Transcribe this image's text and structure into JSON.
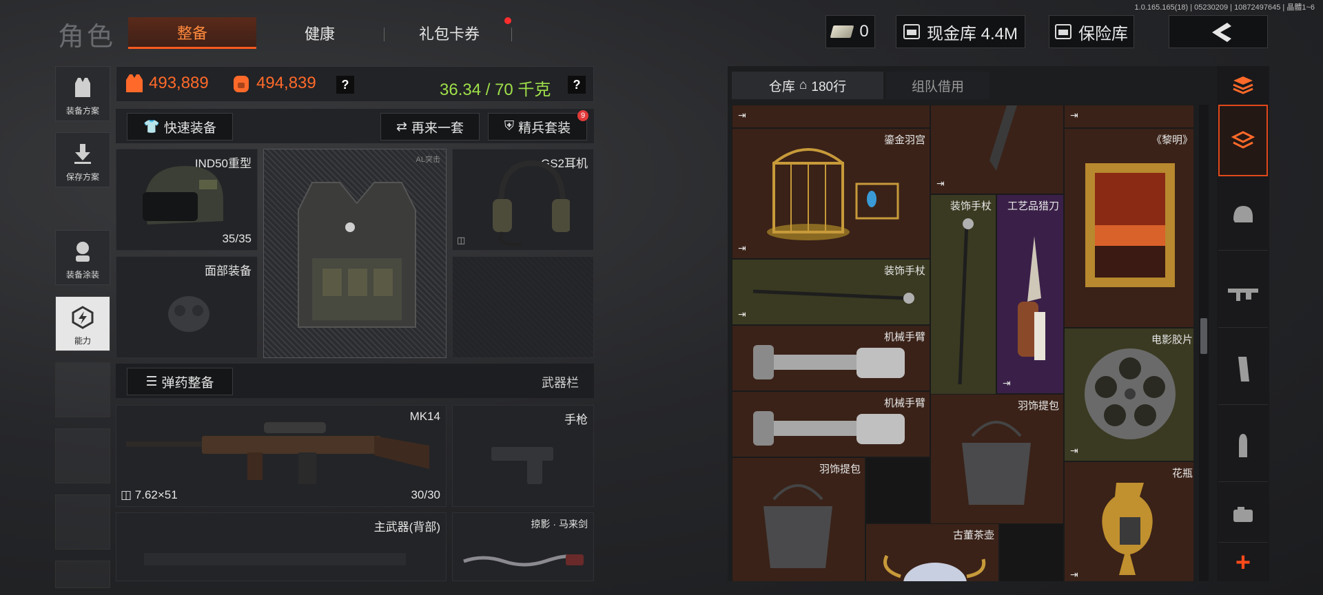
{
  "version": "1.0.165.165(18) | 05230209 | 10872497645 | 晶體1~6",
  "header": {
    "title": "角色",
    "tabs": [
      {
        "label": "整备",
        "active": true
      },
      {
        "label": "健康",
        "active": false
      },
      {
        "label": "礼包卡券",
        "active": false,
        "badge": true
      }
    ],
    "cash_count": "0",
    "vault_label": "现金库 4.4M",
    "safe_label": "保险库"
  },
  "rail": {
    "items": [
      {
        "label": "装备方案",
        "icon": "vest-icon"
      },
      {
        "label": "保存方案",
        "icon": "download-icon"
      },
      {
        "label": "装备涂装",
        "icon": "soldier-icon"
      },
      {
        "label": "能力",
        "icon": "ability-icon",
        "active": true
      }
    ]
  },
  "stats": {
    "armor_value": "493,889",
    "bag_value": "494,839",
    "weight": "36.34 / 70 千克",
    "help": "?"
  },
  "actions": {
    "quick_equip": "快速装备",
    "another_set": "再来一套",
    "elite_set": "精兵套装",
    "elite_badge": "9",
    "ammo_equip": "弹药整备",
    "weapon_bar": "武器栏"
  },
  "gear": {
    "helmet": {
      "name": "IND50重型",
      "durability": "35/35"
    },
    "armor": {
      "name": "AL突击"
    },
    "headset": {
      "name": "GS2耳机"
    },
    "face": {
      "name": "面部装备"
    },
    "primary": {
      "name": "MK14",
      "caliber": "7.62×51",
      "ammo": "30/30"
    },
    "pistol": {
      "name": "手枪"
    },
    "back_weapon": {
      "name": "主武器(背部)"
    },
    "melee": {
      "name": "掠影 · 马来剑"
    }
  },
  "warehouse": {
    "tab_storage": "仓库",
    "rows": "180行",
    "tab_team": "组队借用",
    "items": {
      "birdcage": "鎏金羽宫",
      "painting": "《黎明》",
      "cane1": "装饰手杖",
      "cane2": "装饰手杖",
      "knife": "工艺品猎刀",
      "arm1": "机械手臂",
      "arm2": "机械手臂",
      "film": "电影胶片",
      "bag1": "羽饰提包",
      "bag2": "羽饰提包",
      "vase": "花瓶",
      "teapot": "古董茶壶"
    },
    "exit_glyph": "⇥",
    "add_glyph": "+"
  },
  "colors": {
    "accent": "#ff5a1f",
    "green": "#9fe04a",
    "brown_cell": "#3a2218",
    "olive_cell": "#3a3a22",
    "purple_cell": "#3a2048"
  }
}
